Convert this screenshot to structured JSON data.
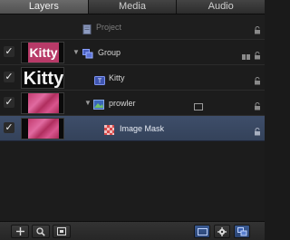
{
  "tabs": [
    {
      "label": "Layers",
      "active": true
    },
    {
      "label": "Media",
      "active": false
    },
    {
      "label": "Audio",
      "active": false
    }
  ],
  "project": {
    "label": "Project"
  },
  "layers": [
    {
      "name": "Group",
      "enabled": true,
      "thumbnail_text": "Kitty",
      "icon": "group-icon"
    },
    {
      "name": "Kitty",
      "enabled": true,
      "thumbnail_text": "Kitty",
      "icon": "text-layer-icon"
    },
    {
      "name": "prowler",
      "enabled": true,
      "icon": "image-layer-icon"
    },
    {
      "name": "Image Mask",
      "enabled": true,
      "selected": true,
      "icon": "mask-icon"
    }
  ],
  "checkmark_glyph": "✓",
  "toolbar": {
    "left_buttons": [
      "add-icon",
      "search-icon",
      "filter-icon"
    ],
    "right_buttons": [
      "view-icon",
      "gear-icon",
      "layers-icon"
    ]
  },
  "colors": {
    "selected_row": "#3e4e6a",
    "thumb_pink": "#c23a6e",
    "accent_blue": "#4a78c8"
  }
}
